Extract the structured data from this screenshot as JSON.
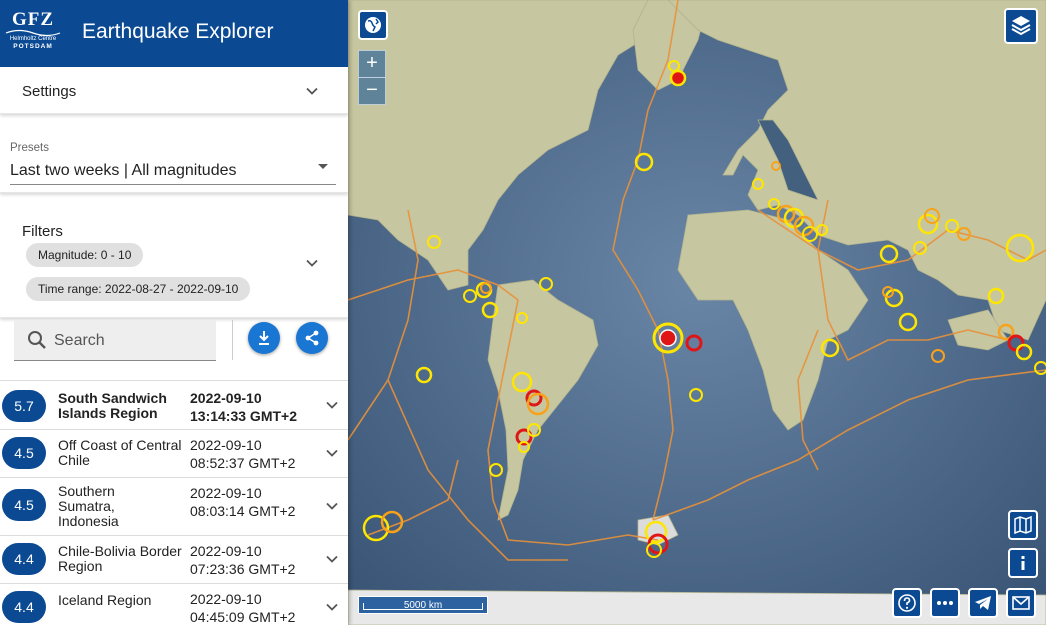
{
  "header": {
    "logo_main": "GFZ",
    "logo_sub1": "Helmholtz Centre",
    "logo_sub2": "POTSDAM",
    "title": "Earthquake Explorer"
  },
  "settings": {
    "label": "Settings"
  },
  "presets": {
    "caption": "Presets",
    "value": "Last two weeks | All magnitudes"
  },
  "filters": {
    "label": "Filters",
    "chips": [
      "Magnitude: 0 - 10",
      "Time range: 2022-08-27 - 2022-09-10"
    ]
  },
  "search": {
    "placeholder": "Search"
  },
  "events": [
    {
      "magnitude": "5.7",
      "region": "South Sandwich Islands Region",
      "date": "2022-09-10",
      "time": "13:14:33 GMT+2",
      "selected": true
    },
    {
      "magnitude": "4.5",
      "region": "Off Coast of Central Chile",
      "date": "2022-09-10",
      "time": "08:52:37 GMT+2"
    },
    {
      "magnitude": "4.5",
      "region": "Southern Sumatra, Indonesia",
      "date": "2022-09-10",
      "time": "08:03:14 GMT+2"
    },
    {
      "magnitude": "4.4",
      "region": "Chile-Bolivia Border Region",
      "date": "2022-09-10",
      "time": "07:23:36 GMT+2"
    },
    {
      "magnitude": "4.4",
      "region": "Iceland Region",
      "date": "2022-09-10",
      "time": "04:45:09 GMT+2"
    }
  ],
  "map": {
    "scale_label": "5000 km",
    "colors": {
      "ocean": "#44607f",
      "land": "#c9c9a4",
      "plate_boundary": "#e8913a",
      "marker_yellow": "#ffe600",
      "marker_orange": "#f7a21a",
      "marker_red": "#e01616",
      "accent": "#0b4a93"
    },
    "icons": [
      "globe-icon",
      "layers-icon",
      "map-icon",
      "info-icon",
      "help-icon",
      "more-icon",
      "telegram-icon",
      "mail-icon"
    ]
  }
}
